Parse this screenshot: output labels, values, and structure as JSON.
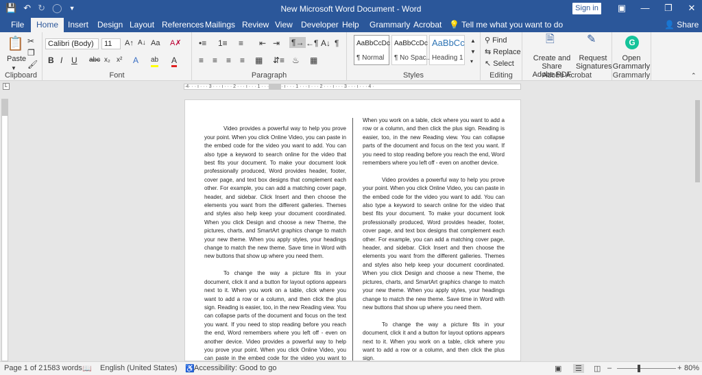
{
  "titlebar": {
    "title": "New Microsoft Word Document  -  Word",
    "sign_in": "Sign in",
    "save_icon": "save-icon",
    "undo_icon": "undo-icon",
    "redo_icon": "redo-icon"
  },
  "tabs": [
    "File",
    "Home",
    "Insert",
    "Design",
    "Layout",
    "References",
    "Mailings",
    "Review",
    "View",
    "Developer",
    "Help",
    "Grammarly",
    "Acrobat"
  ],
  "tell_me": "Tell me what you want to do",
  "share": "Share",
  "ribbon": {
    "clipboard": {
      "paste": "Paste",
      "label": "Clipboard"
    },
    "font": {
      "name": "Calibri (Body)",
      "size": "11",
      "label": "Font"
    },
    "paragraph": {
      "label": "Paragraph"
    },
    "styles": {
      "label": "Styles",
      "items": [
        {
          "preview": "AaBbCcDc",
          "name": "¶ Normal"
        },
        {
          "preview": "AaBbCcDc",
          "name": "¶ No Spac..."
        },
        {
          "preview": "AaBbCc",
          "name": "Heading 1"
        }
      ]
    },
    "editing": {
      "find": "Find",
      "replace": "Replace",
      "select": "Select",
      "label": "Editing"
    },
    "adobe": {
      "create_share": "Create and Share",
      "adobe_pdf": "Adobe PDF",
      "request": "Request",
      "signatures": "Signatures",
      "label": "Adobe Acrobat"
    },
    "grammarly": {
      "open": "Open",
      "grammarly": "Grammarly",
      "label": "Grammarly"
    }
  },
  "ruler_text": "·4· · · ı · · · 3 · · · ı · · · 2 · · · ı · · · 1 · · ·",
  "ruler_text2": "· ı · · · 1 · · · ı · · · 2 · · · ı · · · 3 · · · ı · · · 4 · ",
  "document": {
    "left_col": [
      "Video provides a powerful way to help you prove your point. When you click Online Video, you can paste in the embed code for the video you want to add. You can also type a keyword to search online for the video that best fits your document. To make your document look professionally produced, Word provides header, footer, cover page, and text box designs that complement each other. For example, you can add a matching cover page, header, and sidebar. Click Insert and then choose the elements you want from the different galleries. Themes and styles also help keep your document coordinated. When you click Design and choose a new Theme, the pictures, charts, and SmartArt graphics change to match your new theme. When you apply styles, your headings change to match the new theme. Save time in Word with new buttons that show up where you need them.",
      "To change the way a picture fits in your document, click it and a button for layout options appears next to it. When you work on a table, click where you want to add a row or a column, and then click the plus sign. Reading is easier, too, in the new Reading view. You can collapse parts of the document and focus on the text you want. If you need to stop reading before you reach the end, Word remembers where you left off - even on another device. Video provides a powerful way to help you prove your point. When you click Online Video, you can paste in the embed code for the video you want to add."
    ],
    "right_col_first": "When you work on a table, click where you want to add a row or a column, and then click the plus sign. Reading is easier, too, in the new Reading view. You can collapse parts of the document and focus on the text you want. If you need to stop reading before you reach the end, Word remembers where you left off - even on another device.",
    "right_col": [
      "Video provides a powerful way to help you prove your point. When you click Online Video, you can paste in the embed code for the video you want to add. You can also type a keyword to search online for the video that best fits your document. To make your document look professionally produced, Word provides header, footer, cover page, and text box designs that complement each other. For example, you can add a matching cover page, header, and sidebar. Click Insert and then choose the elements you want from the different galleries. Themes and styles also help keep your document coordinated. When you click Design and choose a new Theme, the pictures, charts, and SmartArt graphics change to match your new theme. When you apply styles, your headings change to match the new theme. Save time in Word with new buttons that show up where you need them.",
      "To change the way a picture fits in your document, click it and a button for layout options appears next to it. When you work on a table, click where you want to add a row or a column, and then click the plus sign."
    ]
  },
  "status": {
    "page": "Page 1 of 2",
    "words": "1583 words",
    "language": "English (United States)",
    "accessibility": "Accessibility: Good to go",
    "zoom": "80%"
  },
  "colors": {
    "accent": "#2b579a",
    "ribbon_bg": "#f3f3f3",
    "workspace": "#e6e6e6",
    "grammarly": "#15c39a"
  }
}
